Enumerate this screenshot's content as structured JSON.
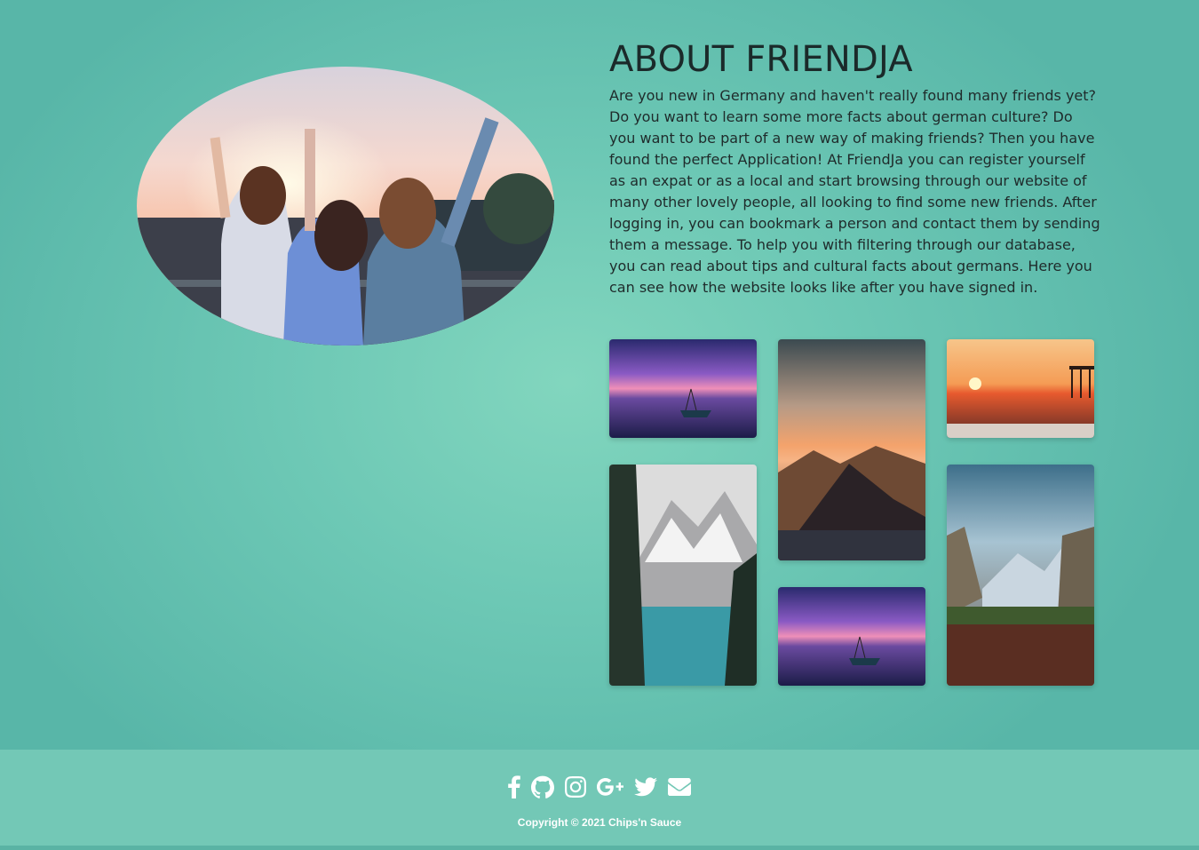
{
  "about": {
    "title": "ABOUT FRIENDJA",
    "body": "Are you new in Germany and haven't really found many friends yet? Do you want to learn some more facts about german culture? Do you want to be part of a new way of making friends? Then you have found the perfect Application! At FriendJa you can register yourself as an expat or as a local and start browsing through our website of many other lovely people, all looking to find some new friends. After logging in, you can bookmark a person and contact them by sending them a message. To help you with filtering through our database, you can read about tips and cultural facts about germans. Here you can see how the website looks like after you have signed in."
  },
  "gallery": [
    {
      "icon": "lake-boat-sunset-photo"
    },
    {
      "icon": "mountain-sunset-photo"
    },
    {
      "icon": "pier-sunset-photo"
    },
    {
      "icon": "snowy-lake-photo"
    },
    {
      "icon": "lake-boat-sunset-photo"
    },
    {
      "icon": "yosemite-valley-photo"
    }
  ],
  "footer": {
    "social": [
      "facebook-icon",
      "github-icon",
      "instagram-icon",
      "google-plus-icon",
      "twitter-icon",
      "envelope-icon"
    ],
    "copyright": "Copyright © 2021 Chips'n Sauce"
  },
  "colors": {
    "background": "#6dc8b5",
    "footer": "#73c8b6",
    "text": "#1f2b2b"
  }
}
